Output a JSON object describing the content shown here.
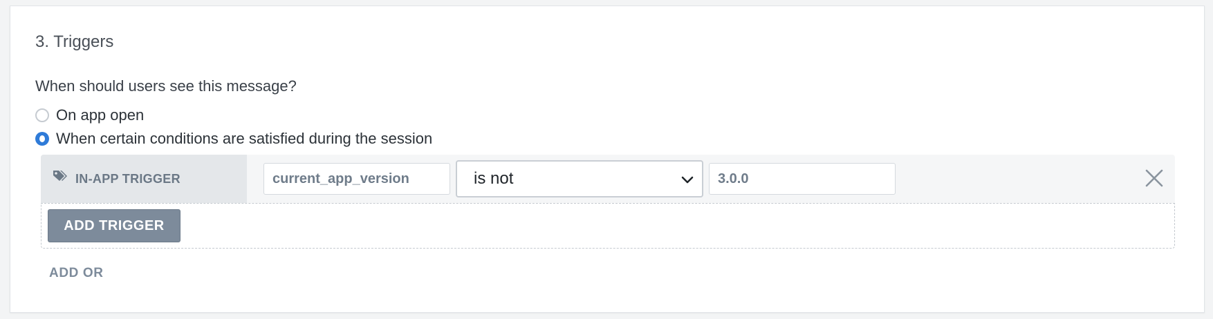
{
  "section": {
    "title": "3. Triggers",
    "question": "When should users see this message?"
  },
  "options": [
    {
      "label": "On app open",
      "selected": false
    },
    {
      "label": "When certain conditions are satisfied during the session",
      "selected": true
    }
  ],
  "trigger": {
    "label": "IN-APP TRIGGER",
    "label_icon": "tag-icon",
    "event_value": "current_app_version",
    "operator_value": "is not",
    "comparison_value": "3.0.0",
    "remove_icon": "close-icon"
  },
  "buttons": {
    "add_trigger": "ADD TRIGGER",
    "add_or": "ADD OR"
  },
  "colors": {
    "accent": "#2f7bd8",
    "button": "#7d8b9b",
    "label_bg": "#e4e7ea"
  }
}
